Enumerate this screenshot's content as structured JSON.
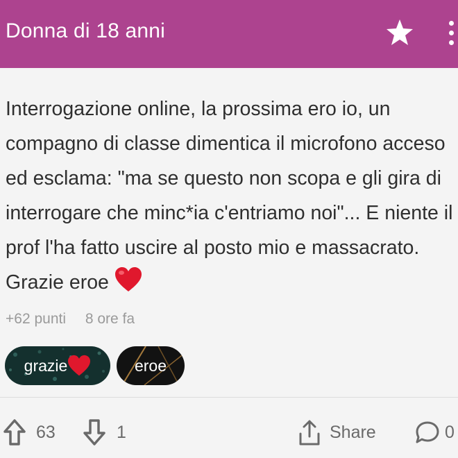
{
  "header": {
    "title": "Donna di 18 anni",
    "background": "#ad438f",
    "star_icon": "star-icon",
    "menu_icon": "more-vertical-icon"
  },
  "post": {
    "text": "Interrogazione online, la prossima ero io, un compagno di classe dimentica il microfono acceso ed esclama: \"ma se questo non scopa e gli gira di interrogare che minc*ia c'entriamo noi\"... E niente il prof l'ha fatto uscire al posto mio e massacrato. Grazie eroe",
    "text_emoji": "heart-icon",
    "points": "+62 punti",
    "time": "8 ore fa"
  },
  "tags": [
    {
      "label": "grazie",
      "emoji": "heart-icon"
    },
    {
      "label": "eroe"
    }
  ],
  "actions": {
    "upvotes": "63",
    "downvotes": "1",
    "share_label": "Share",
    "comments": "0"
  },
  "colors": {
    "heart": "#e0182d",
    "icon_gray": "#6a6a6a"
  }
}
